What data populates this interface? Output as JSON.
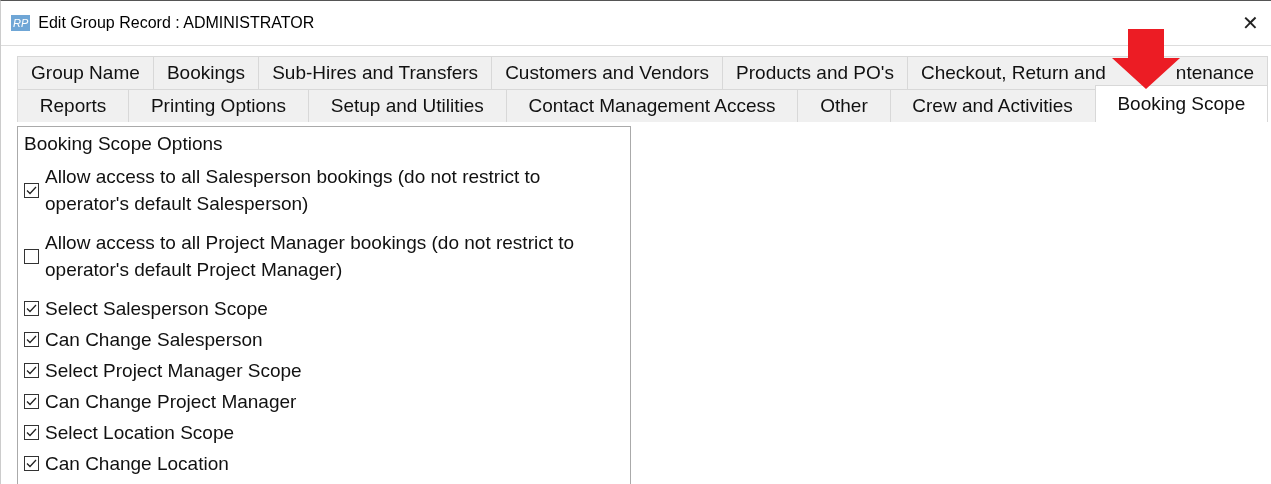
{
  "window": {
    "title": "Edit Group Record : ADMINISTRATOR",
    "app_badge": "RP",
    "close": "✕"
  },
  "tab_rows": [
    [
      {
        "label": "Group Name",
        "selected": false
      },
      {
        "label": "Bookings",
        "selected": false
      },
      {
        "label": "Sub-Hires and Transfers",
        "selected": false
      },
      {
        "label": "Customers and Vendors",
        "selected": false
      },
      {
        "label": "Products and PO's",
        "selected": false
      },
      {
        "label": "Checkout, Return and",
        "label_after_arrow": "ntenance",
        "selected": false
      }
    ],
    [
      {
        "label": "Reports",
        "selected": false
      },
      {
        "label": "Printing Options",
        "selected": false
      },
      {
        "label": "Setup and Utilities",
        "selected": false
      },
      {
        "label": "Contact Management Access",
        "selected": false
      },
      {
        "label": "Other",
        "selected": false
      },
      {
        "label": "Crew and Activities",
        "selected": false
      },
      {
        "label": "Booking Scope",
        "selected": true
      }
    ]
  ],
  "panel": {
    "title": "Booking Scope Options",
    "options": [
      {
        "label": "Allow access to all Salesperson bookings (do not restrict to operator's default Salesperson)",
        "checked": true
      },
      {
        "label": "Allow access to all Project Manager bookings (do not restrict to operator's default Project Manager)",
        "checked": false
      },
      {
        "label": "Select Salesperson Scope",
        "checked": true
      },
      {
        "label": "Can Change Salesperson",
        "checked": true
      },
      {
        "label": "Select Project Manager Scope",
        "checked": true
      },
      {
        "label": "Can Change Project Manager",
        "checked": true
      },
      {
        "label": "Select Location Scope",
        "checked": true
      },
      {
        "label": "Can Change Location",
        "checked": true
      }
    ]
  },
  "annotation": {
    "kind": "arrow"
  }
}
